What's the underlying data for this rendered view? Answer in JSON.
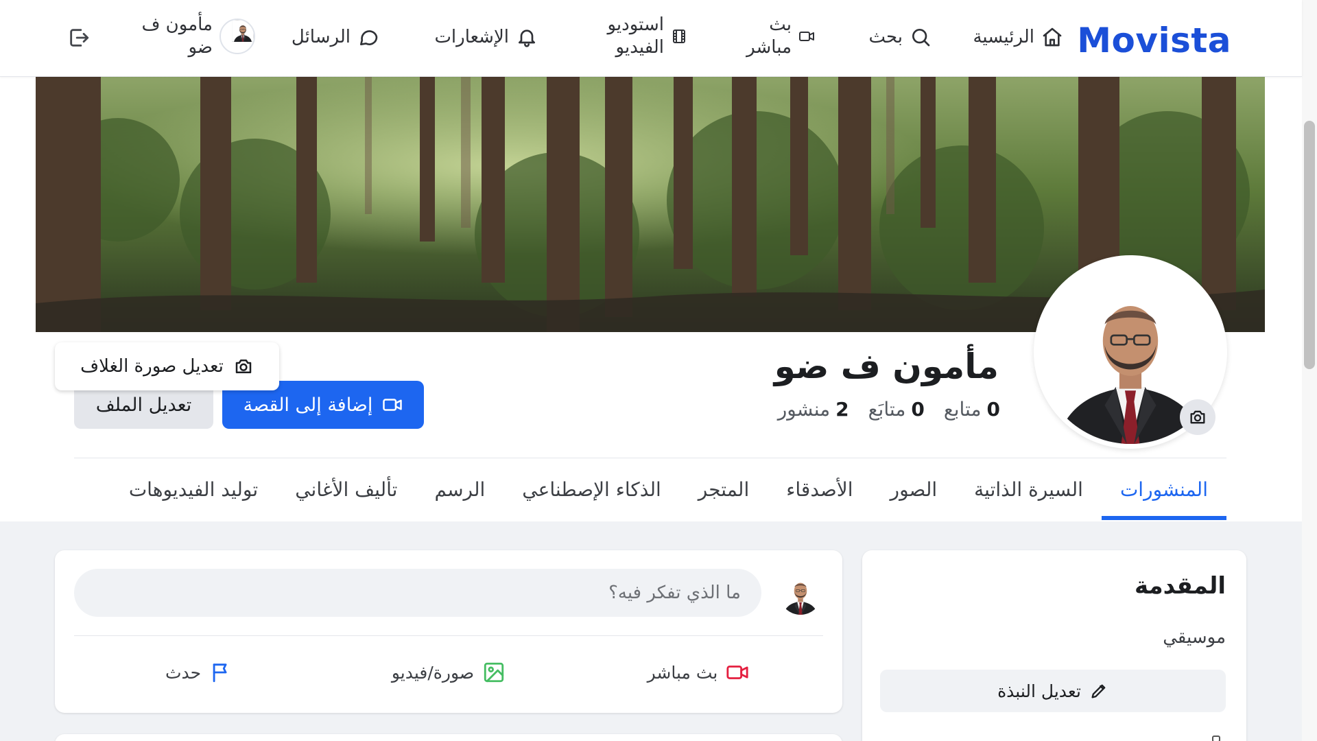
{
  "app": {
    "logo": "Movista"
  },
  "nav": {
    "home": "الرئيسية",
    "search": "بحث",
    "live_line1": "بث",
    "live_line2": "مباشر",
    "studio_line1": "استوديو",
    "studio_line2": "الفيديو",
    "notifications": "الإشعارات",
    "messages": "الرسائل",
    "user_line1": "مأمون ف",
    "user_line2": "ضو"
  },
  "profile": {
    "name": "مأمون ف ضو",
    "edit_cover": "تعديل صورة الغلاف",
    "add_story": "إضافة إلى القصة",
    "edit_profile": "تعديل الملف",
    "stats": {
      "followers_count": "0",
      "followers_label": "متابع",
      "following_count": "0",
      "following_label": "متابَع",
      "posts_count": "2",
      "posts_label": "منشور"
    }
  },
  "tabs": [
    {
      "label": "المنشورات"
    },
    {
      "label": "السيرة الذاتية"
    },
    {
      "label": "الصور"
    },
    {
      "label": "الأصدقاء"
    },
    {
      "label": "المتجر"
    },
    {
      "label": "الذكاء الإصطناعي"
    },
    {
      "label": "الرسم"
    },
    {
      "label": "تأليف الأغاني"
    },
    {
      "label": "توليد الفيديوهات"
    }
  ],
  "intro": {
    "title": "المقدمة",
    "bio": "موسيقي",
    "edit_bio": "تعديل النبذة"
  },
  "composer": {
    "placeholder": "ما الذي تفكر فيه؟",
    "live": "بث مباشر",
    "photo": "صورة/فيديو",
    "event": "حدث"
  },
  "colors": {
    "brand": "#1b4fd8",
    "primary_button": "#1d66f0",
    "live_red": "#e41e3f",
    "photo_green": "#45bd62",
    "event_blue": "#1d66f0"
  },
  "icons": [
    "home-icon",
    "search-icon",
    "video-icon",
    "film-icon",
    "bell-icon",
    "message-icon",
    "logout-icon",
    "camera-icon",
    "pencil-icon",
    "image-icon",
    "flag-icon"
  ]
}
